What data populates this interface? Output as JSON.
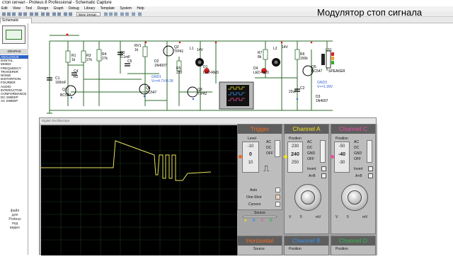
{
  "window": {
    "title": "стоп сигнал - Proteus 8 Professional - Schematic Capture"
  },
  "menu": [
    "Edit",
    "View",
    "Tool",
    "Design",
    "Graph",
    "Debug",
    "Library",
    "Template",
    "System",
    "Help"
  ],
  "toolbar": {
    "design_select": "Base Design"
  },
  "tab": {
    "label": "Schematic Capture"
  },
  "left": {
    "mode_label": "GRAPHS",
    "graphs": [
      "ANALOGUE",
      "DIGITAL",
      "MIXED",
      "FREQUENCY",
      "TRANSFER",
      "NOISE",
      "DISTORTION",
      "FOURIER",
      "AUDIO",
      "INTERACTIVE",
      "CONFORMANCE",
      "DC SWEEP",
      "AC SWEEP"
    ],
    "selected": 0,
    "note": [
      "файл",
      "для",
      "Proteus",
      "под",
      "видео"
    ]
  },
  "heading": "Модулятор стоп сигнала",
  "schematic": {
    "labels": [
      "R1",
      "1k",
      "R3",
      "27k",
      "R4",
      "27k",
      "C3",
      "0.1mF",
      "RV1",
      "1k",
      "Q2",
      "TIP41",
      "L1",
      "14V",
      "R7",
      "8k",
      "L2",
      "14V",
      "R6",
      "150k",
      "LS1",
      "C4",
      "SPEAKER",
      "C1",
      "100mF",
      "C5",
      "Q1",
      "BC547",
      "R2",
      "D2",
      "1N4007",
      "R5",
      "220",
      "D1",
      "LED-RED",
      "D4",
      "LED-RED",
      "Q5",
      "BC547",
      "Q4",
      "BC547",
      "Q3",
      "TIP42",
      "C2",
      "22uF",
      "D3",
      "1N4007",
      "GND1",
      "V+=4.7V/0.28",
      "GND3",
      "V+=1.99V"
    ]
  },
  "oscilloscope": {
    "title": "Digital Oscilloscope",
    "trigger": {
      "title": "Trigger",
      "level_label": "Level",
      "level_values": [
        "-10",
        "0",
        "10"
      ],
      "ac": "AC",
      "dc": "DC",
      "off": "OFF",
      "auto": "Auto",
      "one_shot": "One-Shot",
      "cursors": "Cursors",
      "source": "Source",
      "source_letters": [
        "A",
        "B",
        "C",
        "D"
      ]
    },
    "channel_a": {
      "title": "Channel A",
      "position": "Position",
      "values": [
        "230",
        "240",
        "250"
      ],
      "ac": "AC",
      "dc": "DC",
      "gnd": "GND",
      "off": "OFF",
      "invert": "Invert",
      "aplusb": "A+B",
      "scale": [
        "0.5",
        "1",
        "2",
        "5",
        "10",
        "20",
        "50"
      ],
      "unit_v": "V",
      "val": "5",
      "unit_mv": "mV"
    },
    "channel_c": {
      "title": "Channel C",
      "position": "Position",
      "values": [
        "-50",
        "-40",
        "-30"
      ],
      "ac": "AC",
      "dc": "DC",
      "gnd": "GND",
      "off": "OFF",
      "invert": "Invert",
      "aplusb": "A+B",
      "scale": [
        "0.5",
        "1",
        "2",
        "5",
        "10",
        "20",
        "50"
      ],
      "unit_v": "V",
      "val": "5",
      "unit_mv": "mV"
    },
    "horizontal": {
      "title": "Horizontal",
      "source": "Source"
    },
    "channel_b": {
      "title": "Channel B",
      "position": "Position"
    },
    "channel_d": {
      "title": "Channel D",
      "position": "Position"
    },
    "colors": {
      "trigger": "#f36a1f",
      "channel_a": "#f2e21a",
      "channel_b": "#3a8ee8",
      "channel_c": "#ea4ea0",
      "channel_d": "#36b34a"
    }
  }
}
